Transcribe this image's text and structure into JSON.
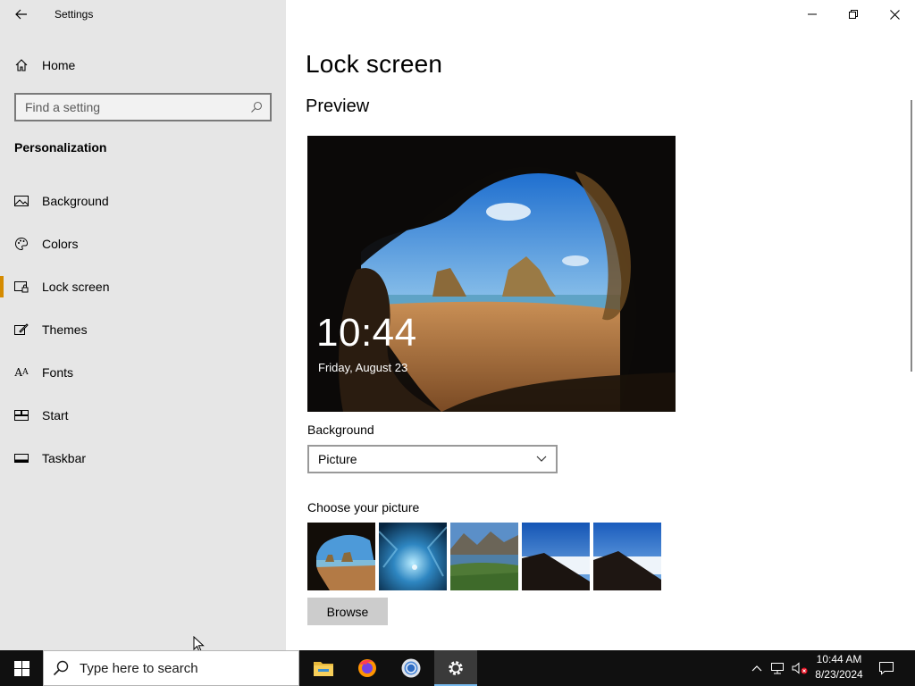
{
  "window": {
    "app_title": "Settings",
    "icons": {
      "back": "back-arrow-icon",
      "minimize": "minimize-icon",
      "restore": "restore-icon",
      "close": "close-icon"
    }
  },
  "sidebar": {
    "home_label": "Home",
    "search_placeholder": "Find a setting",
    "section_title": "Personalization",
    "items": [
      {
        "label": "Background",
        "icon": "picture-icon",
        "selected": false
      },
      {
        "label": "Colors",
        "icon": "palette-icon",
        "selected": false
      },
      {
        "label": "Lock screen",
        "icon": "lock-screen-icon",
        "selected": true
      },
      {
        "label": "Themes",
        "icon": "brush-icon",
        "selected": false
      },
      {
        "label": "Fonts",
        "icon": "font-icon",
        "selected": false
      },
      {
        "label": "Start",
        "icon": "start-tiles-icon",
        "selected": false
      },
      {
        "label": "Taskbar",
        "icon": "taskbar-icon",
        "selected": false
      }
    ],
    "accent_color": "#d58b00"
  },
  "main": {
    "page_title": "Lock screen",
    "preview_title": "Preview",
    "preview_time": "10:44",
    "preview_date": "Friday, August 23",
    "background_label": "Background",
    "background_value": "Picture",
    "choose_picture_label": "Choose your picture",
    "browse_label": "Browse"
  },
  "taskbar": {
    "search_placeholder": "Type here to search",
    "apps": [
      "file-explorer-icon",
      "firefox-icon",
      "chrome-icon",
      "settings-gear-icon"
    ],
    "active_app": "settings-gear-icon",
    "time": "10:44 AM",
    "date": "8/23/2024"
  }
}
